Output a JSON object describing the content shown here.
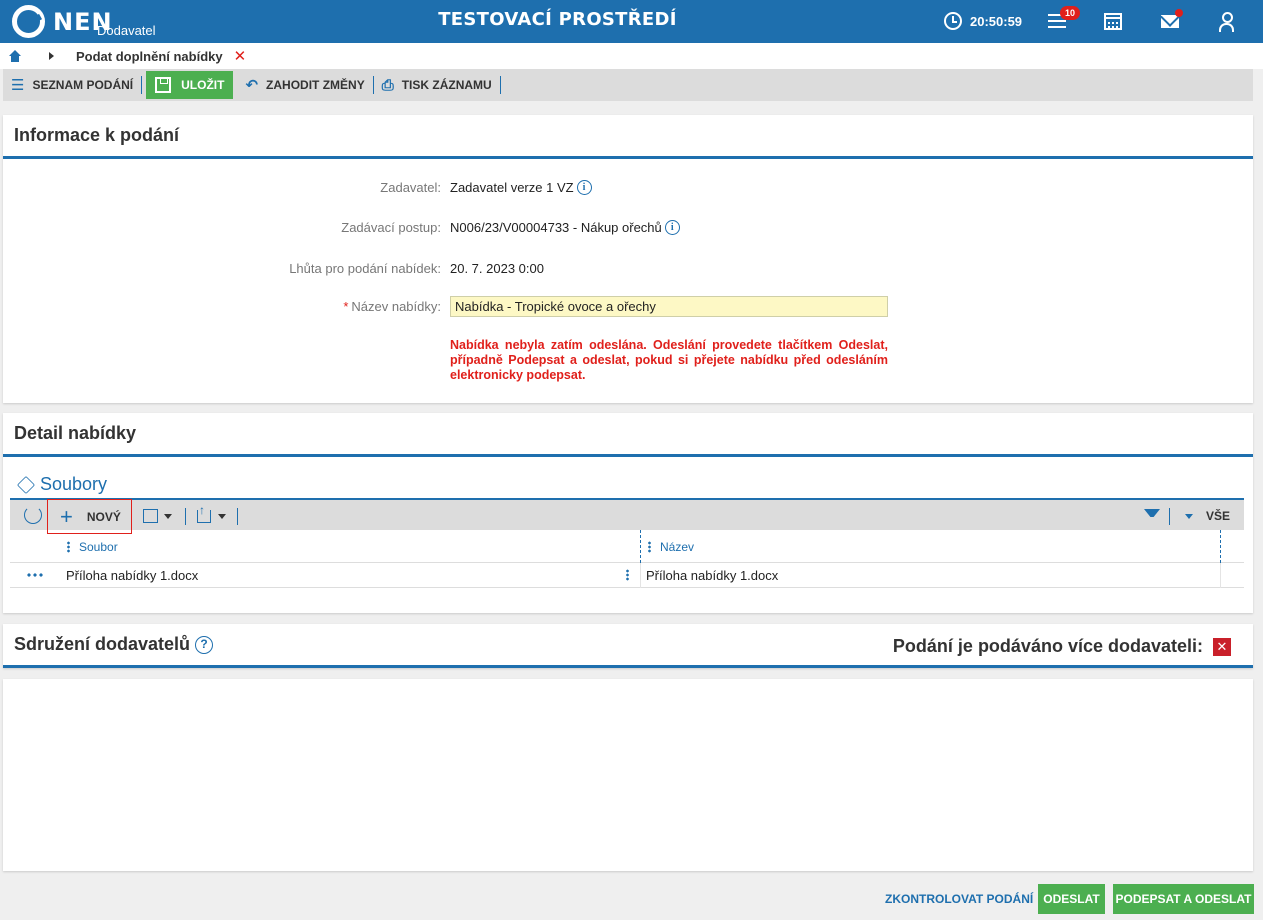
{
  "header": {
    "logo": "NEN",
    "logo_sub": "Dodavatel",
    "env_title": "TESTOVACÍ PROSTŘEDÍ",
    "time": "20:50:59",
    "notifications_count": "10",
    "icons": [
      "clock-icon",
      "menu-icon",
      "calculator-icon",
      "mail-icon",
      "user-icon"
    ],
    "brand_color": "#1e6fae"
  },
  "breadcrumb": {
    "current": "Podat doplnění nabídky"
  },
  "toolbar": {
    "list_label": "SEZNAM PODÁNÍ",
    "save_label": "ULOŽIT",
    "discard_label": "ZAHODIT ZMĚNY",
    "print_label": "TISK ZÁZNAMU"
  },
  "info": {
    "title": "Informace k podání",
    "contracting_label": "Zadavatel:",
    "contracting_value": "Zadavatel verze 1 VZ",
    "procedure_label": "Zadávací postup:",
    "procedure_value": "N006/23/V00004733 - Nákup ořechů",
    "deadline_label": "Lhůta pro podání nabídek:",
    "deadline_value": "20. 7. 2023 0:00",
    "name_required": "*",
    "name_label": "Název nabídky:",
    "name_value": "Nabídka - Tropické ovoce a ořechy",
    "warning": "Nabídka nebyla zatím odeslána. Odeslání provedete tlačítkem Odeslat, případně Podepsat a odeslat, pokud si přejete nabídku před odesláním elektronicky podepsat."
  },
  "detail": {
    "title": "Detail nabídky",
    "files_title": "Soubory",
    "new_label": "NOVÝ",
    "all_label": "VŠE",
    "columns": [
      "Soubor",
      "Název"
    ],
    "rows": [
      {
        "file": "Příloha nabídky 1.docx",
        "name": "Příloha nabídky 1.docx"
      }
    ]
  },
  "association": {
    "title": "Sdružení dodavatelů",
    "multi_label": "Podání je podáváno více dodavateli:",
    "multi_value": "✕"
  },
  "footer": {
    "check_label": "ZKONTROLOVAT PODÁNÍ",
    "send_label": "ODESLAT",
    "sign_send_label": "PODEPSAT A ODESLAT"
  }
}
